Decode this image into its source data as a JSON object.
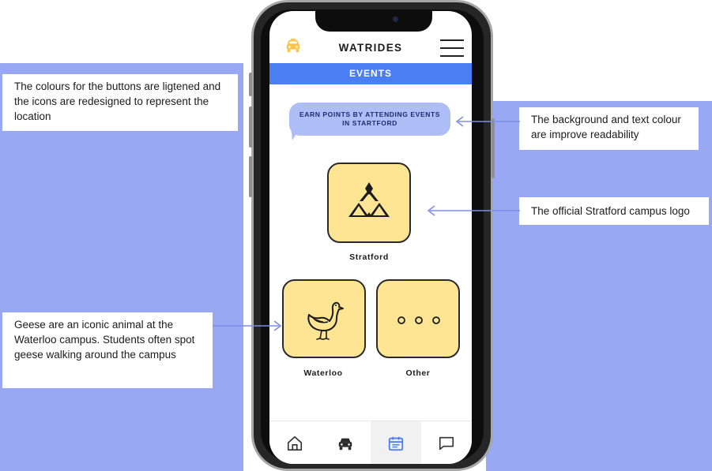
{
  "notes": {
    "buttons": "The colours for the buttons are ligtened and the icons are redesigned to represent the location",
    "readability": "The background and text colour are improve readability",
    "logo": "The official Stratford campus logo",
    "geese": "Geese are an iconic animal at the Waterloo campus. Students often spot geese walking around the campus"
  },
  "app": {
    "title": "WATRIDES",
    "section": "EVENTS",
    "banner_line1": "EARN POINTS BY ATTENDING EVENTS",
    "banner_line2": "IN STARTFORD"
  },
  "tiles": {
    "stratford": "Stratford",
    "waterloo": "Waterloo",
    "other": "Other"
  },
  "tabs": [
    "home",
    "rides",
    "events",
    "chat"
  ],
  "colors": {
    "backdrop": "#98a8f3",
    "primary": "#4a7ef2",
    "tile": "#fde594",
    "banner": "#aebdf6",
    "taxi": "#f5c64a"
  },
  "icons": {
    "header": [
      "taxi-icon",
      "menu-icon"
    ],
    "tiles": [
      "stratford-logo-icon",
      "goose-icon",
      "ellipsis-icon"
    ],
    "tabbar": [
      "home-icon",
      "car-icon",
      "calendar-icon",
      "chat-icon"
    ]
  }
}
